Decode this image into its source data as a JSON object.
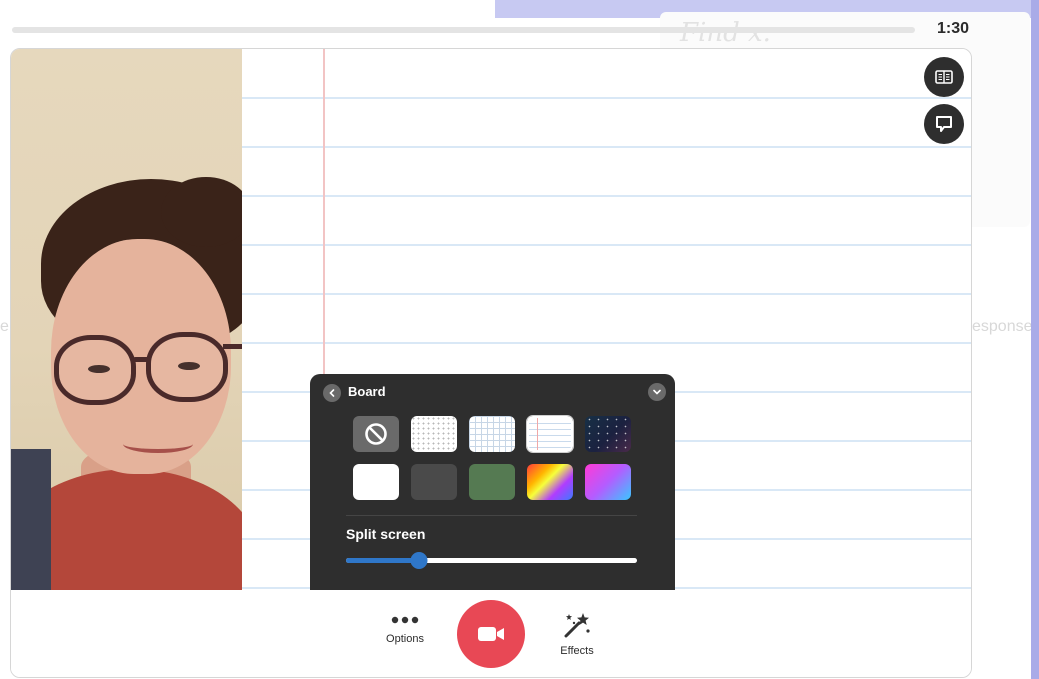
{
  "background_page": {
    "left_fragment": "e",
    "right_fragment": "esponse",
    "sketch_text": "Find x."
  },
  "timer": "1:30",
  "progress": 0.0,
  "board_panel": {
    "title": "Board",
    "backgrounds": [
      {
        "name": "none",
        "selected": false
      },
      {
        "name": "dots",
        "selected": false
      },
      {
        "name": "grid",
        "selected": false
      },
      {
        "name": "lined-notebook",
        "selected": true
      },
      {
        "name": "space",
        "selected": false
      },
      {
        "name": "white",
        "selected": false
      },
      {
        "name": "dark-gray",
        "selected": false
      },
      {
        "name": "green",
        "selected": false
      },
      {
        "name": "rainbow-gradient",
        "selected": false
      },
      {
        "name": "pink-blue-gradient",
        "selected": false
      }
    ],
    "split_screen_label": "Split screen",
    "split_screen_value": 0.25
  },
  "controls": {
    "options_label": "Options",
    "effects_label": "Effects"
  },
  "colors": {
    "record": "#e84855",
    "slider": "#2f77c9",
    "panel": "#2e2e2e",
    "ruled_line": "#d9e8f6",
    "margin_line": "#f2c4c4"
  },
  "icons": {
    "side_top": "book-icon",
    "side_bottom": "sticky-note-icon",
    "record": "video-camera-icon",
    "options": "more-dots-icon",
    "effects": "magic-wand-icon",
    "swatch_none": "no-background-icon"
  }
}
